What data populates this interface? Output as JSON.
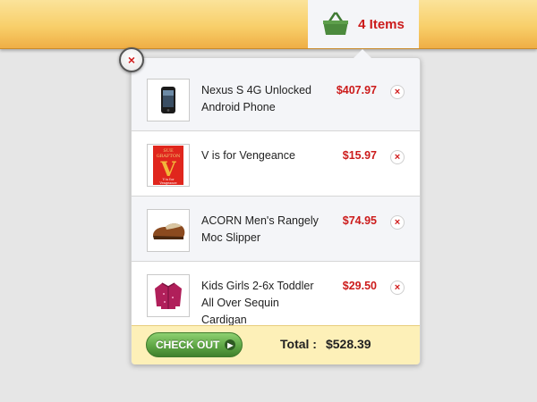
{
  "cart": {
    "count_label": "4 Items",
    "icon": "basket-icon",
    "colors": {
      "accent": "#cc1b1b",
      "basket": "#4c8a3d"
    }
  },
  "items": [
    {
      "name": "Nexus S 4G Unlocked Android Phone",
      "price": "$407.97",
      "thumb": "phone-image"
    },
    {
      "name": "V is for Vengeance",
      "price": "$15.97",
      "thumb": "book-image",
      "thumb_text": {
        "author_line1": "SUE",
        "author_line2": "GRAFTON",
        "letter": "V",
        "title_line1": "V is for",
        "title_line2": "Vengeance"
      }
    },
    {
      "name": "ACORN Men's Rangely Moc Slipper",
      "price": "$74.95",
      "thumb": "slipper-image"
    },
    {
      "name": "Kids Girls 2-6x Toddler All Over Sequin Cardigan",
      "price": "$29.50",
      "thumb": "cardigan-image"
    }
  ],
  "footer": {
    "checkout_label": "CHECK OUT",
    "total_label": "Total :",
    "total_value": "$528.39"
  },
  "remove_glyph": "×",
  "close_glyph": "×"
}
